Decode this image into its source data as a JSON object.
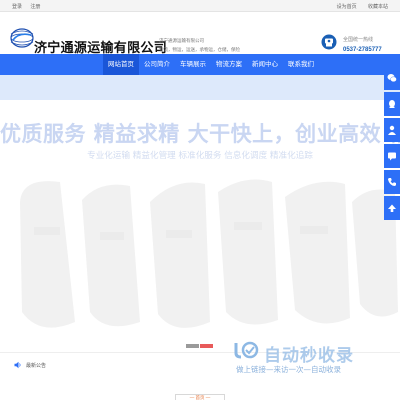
{
  "topbar": {
    "links_left": [
      "登录",
      "注册"
    ],
    "links_right": [
      "设为首页",
      "收藏本站"
    ]
  },
  "header": {
    "company_name": "济宁通源运输有限公司",
    "tagline_line1": "济宁通源运输有限公司",
    "tagline_line2": "物流，物运，运送，承物运，仓储，保险",
    "hotline_label": "全国统一热线",
    "hotline_number": "0537-2785777"
  },
  "nav": {
    "items": [
      {
        "label": "网站首页",
        "active": true
      },
      {
        "label": "公司简介",
        "active": false
      },
      {
        "label": "车辆展示",
        "active": false
      },
      {
        "label": "物流方案",
        "active": false
      },
      {
        "label": "新闻中心",
        "active": false
      },
      {
        "label": "联系我们",
        "active": false
      }
    ]
  },
  "banner": {
    "headline": "优质服务 精益求精 大干快上，创业高效 精益至明 诚信",
    "subline": "专业化运输 精益化管理 标准化服务 信息化调度 精准化追踪",
    "slides": 2,
    "active_slide": 1
  },
  "sidebar": {
    "icons": [
      "wechat-icon",
      "qq-icon",
      "user-icon",
      "message-icon",
      "phone-icon",
      "top-icon"
    ]
  },
  "notice": {
    "label": "最新公告"
  },
  "watermark": {
    "title": "自动秒收录",
    "subtitle": "做上链接—来访一次—自动收录"
  },
  "bottom_tab": {
    "label": "— 首页 —"
  },
  "colors": {
    "nav_blue": "#2d6ff7",
    "band": "#dde9fb",
    "dot_active": "#e85a5a",
    "phone_blue": "#1a5fb4"
  }
}
